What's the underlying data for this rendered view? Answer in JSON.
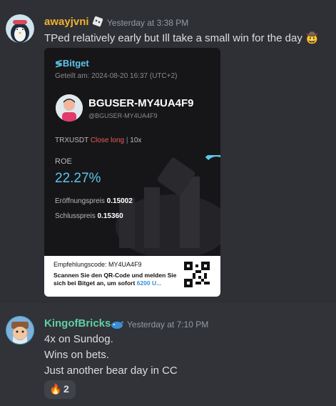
{
  "messages": [
    {
      "author": "awayjvni",
      "author_color": "#f0b132",
      "badge_icon": "dice-icon",
      "timestamp": "Yesterday at 3:38 PM",
      "text": "TPed relatively early but Ill take a small win for the day",
      "trailing_emoji": "🤠",
      "embed": {
        "brand": "Bitget",
        "shared_at": "Geteilt am: 2024-08-20 16:37  (UTC+2)",
        "username": "BGUSER-MY4UA4F9",
        "handle": "@BGUSER-MY4UA4F9",
        "pair": "TRXUSDT",
        "position": "Close long",
        "leverage": "10x",
        "roe_label": "ROE",
        "roe_value": "22.27%",
        "open_price_label": "Eröffnungspreis",
        "open_price": "0.15002",
        "close_price_label": "Schlusspreis",
        "close_price": "0.15360",
        "referral": "Empfehlungscode: MY4UA4F9",
        "cta_text": "Scannen Sie den QR-Code und melden Sie sich bei Bitget an, um sofort",
        "cta_highlight": "6200 U..."
      }
    },
    {
      "author": "KingofBricks",
      "author_color": "#5fd0a4",
      "badge_icon": "whale-icon",
      "timestamp": "Yesterday at 7:10 PM",
      "lines": [
        "4x on Sundog.",
        "Wins on bets.",
        "Just another bear day in CC"
      ],
      "reaction": {
        "emoji": "🔥",
        "count": "2"
      }
    }
  ]
}
